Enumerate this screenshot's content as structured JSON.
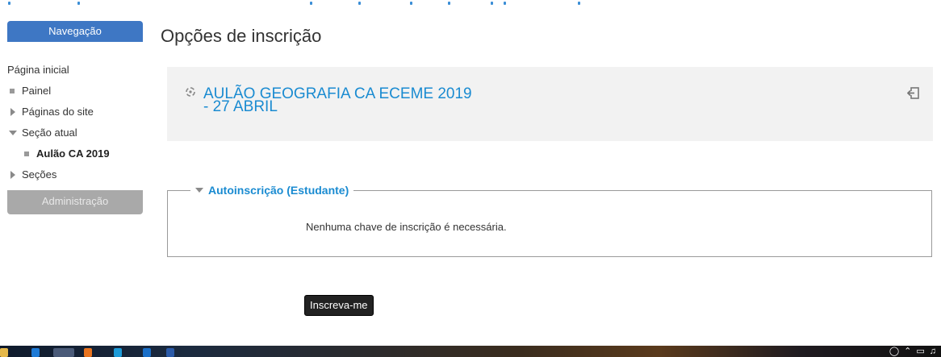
{
  "sidebar": {
    "nav_header": "Navegação",
    "items": [
      {
        "label": "Página inicial"
      },
      {
        "label": "Painel"
      },
      {
        "label": "Páginas do site"
      },
      {
        "label": "Seção atual"
      },
      {
        "label": "Aulão CA 2019"
      },
      {
        "label": "Seções"
      }
    ],
    "admin_header": "Administração"
  },
  "main": {
    "page_title": "Opções de inscrição",
    "course": {
      "title_line1": "AULÃO GEOGRAFIA CA ECEME 2019",
      "title_line2": "- 27 ABRIL"
    },
    "self_enrol": {
      "legend": "Autoinscrição (Estudante)",
      "message": "Nenhuma chave de inscrição é necessária."
    },
    "enrol_button": "Inscreva-me"
  },
  "icons": {
    "course": "course-icon",
    "enrol": "enrol-icon",
    "taskbar": [
      "file-explorer-icon",
      "edge-icon",
      "chrome-icon",
      "firefox-icon",
      "skype-icon",
      "outlook-icon",
      "word-icon"
    ],
    "tray": [
      "people-icon",
      "chevron-up-icon",
      "network-icon",
      "volume-icon"
    ]
  },
  "colors": {
    "nav_header": "#3e77c4",
    "link": "#1a8bd1",
    "admin_header": "#a9a9a9",
    "button": "#222222",
    "course_box": "#f2f2f2"
  }
}
